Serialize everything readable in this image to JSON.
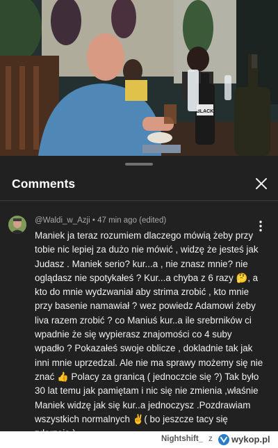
{
  "video": {
    "bottle_label": "BLACK"
  },
  "comments_panel": {
    "title": "Comments",
    "close_icon": "close-icon"
  },
  "comment": {
    "author": "@Waldi_w_Azji",
    "time": "47 min ago (edited)",
    "more_icon": "more-vert-icon",
    "lines": [
      "Maniek ja teraz rozumiem dlaczego mówią żeby przy",
      "tobie nic lepiej za dużo nie mówić , widzę że jesteś jak",
      "Judasz . Maniek serio? kur...a ,  nie znasz mnie? nie",
      "oglądasz nie spotykałeś ? Kur...a chyba z 6 razy 🤔, a",
      "kto do mnie wydzwaniał aby strima zrobić , kto mnie",
      "przy basenie namawiał ? wez powiedz Adamowi żeby",
      "liva razem zrobić ? co Maniuś kur..a ile srebrników ci",
      "wpadnie że się wypierasz znajomości co 4 suby",
      "wpadło ? Pokazałeś swoje oblicze , dokladnie tak jak",
      "inni mnie uprzedzal. Ale nie ma sprawy możemy się nie",
      "znać 👍 Polacy za granicą ( jednoczcie się ?) Tak było",
      "30 lat temu jak pamiętam i nic się nie zmienia ,właśnie",
      "Maniek widzę jak się kur..a jednoczysz  .Pozdrawiam",
      "wszystkich normalnych ✌( bo jeszcze tacy się",
      "zdarzają )"
    ]
  },
  "watermark": {
    "user": "Nightshift_",
    "separator": "z",
    "site": "wykop.pl"
  },
  "colors": {
    "background": "#212121",
    "text_primary": "#f1f1f1",
    "text_secondary": "#aaaaaa",
    "wykop_blue": "#2b7cc8"
  }
}
